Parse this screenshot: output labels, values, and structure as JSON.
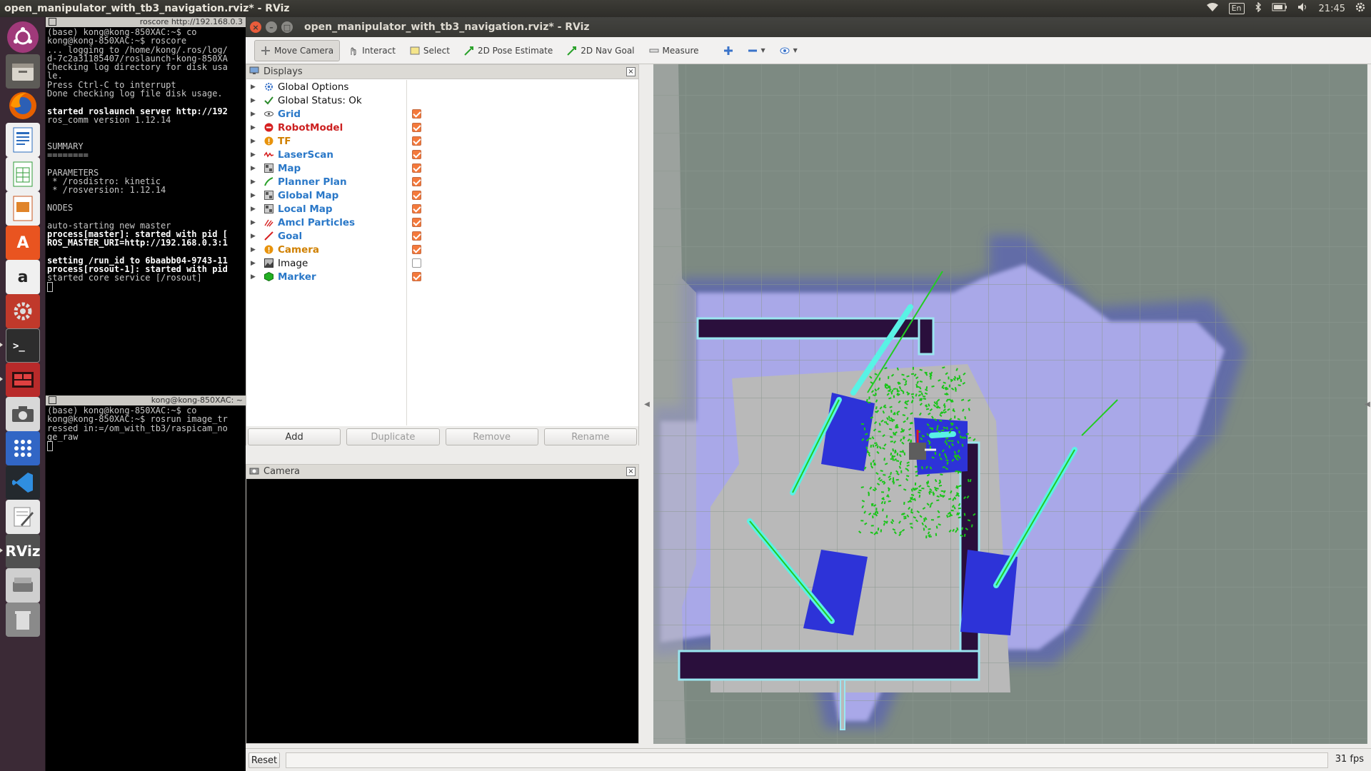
{
  "top_panel": {
    "title": "open_manipulator_with_tb3_navigation.rviz* - RViz",
    "keyboard": "En",
    "clock": "21:45"
  },
  "terminal1": {
    "title": "roscore http://192.168.0.3",
    "lines": [
      {
        "t": "(base) kong@kong-850XAC:~$ co",
        "b": false
      },
      {
        "t": "kong@kong-850XAC:~$ roscore",
        "b": false
      },
      {
        "t": "... logging to /home/kong/.ros/log/",
        "b": false
      },
      {
        "t": "d-7c2a31185407/roslaunch-kong-850XA",
        "b": false
      },
      {
        "t": "Checking log directory for disk usa",
        "b": false
      },
      {
        "t": "le.",
        "b": false
      },
      {
        "t": "Press Ctrl-C to interrupt",
        "b": false
      },
      {
        "t": "Done checking log file disk usage.",
        "b": false
      },
      {
        "t": "",
        "b": false
      },
      {
        "t": "started roslaunch server http://192",
        "b": true
      },
      {
        "t": "ros_comm version 1.12.14",
        "b": false
      },
      {
        "t": "",
        "b": false
      },
      {
        "t": "",
        "b": false
      },
      {
        "t": "SUMMARY",
        "b": false
      },
      {
        "t": "========",
        "b": false
      },
      {
        "t": "",
        "b": false
      },
      {
        "t": "PARAMETERS",
        "b": false
      },
      {
        "t": " * /rosdistro: kinetic",
        "b": false
      },
      {
        "t": " * /rosversion: 1.12.14",
        "b": false
      },
      {
        "t": "",
        "b": false
      },
      {
        "t": "NODES",
        "b": false
      },
      {
        "t": "",
        "b": false
      },
      {
        "t": "auto-starting new master",
        "b": false
      },
      {
        "t": "process[master]: started with pid [",
        "b": true
      },
      {
        "t": "ROS_MASTER_URI=http://192.168.0.3:1",
        "b": true
      },
      {
        "t": "",
        "b": false
      },
      {
        "t": "setting /run_id to 6baabb04-9743-11",
        "b": true
      },
      {
        "t": "process[rosout-1]: started with pid",
        "b": true
      },
      {
        "t": "started core service [/rosout]",
        "b": false
      }
    ]
  },
  "terminal2": {
    "title": "kong@kong-850XAC: ~",
    "lines": [
      {
        "t": "(base) kong@kong-850XAC:~$ co",
        "b": false
      },
      {
        "t": "kong@kong-850XAC:~$ rosrun image_tr",
        "b": false
      },
      {
        "t": "ressed in:=/om_with_tb3/raspicam_no",
        "b": false
      },
      {
        "t": "ge_raw",
        "b": false
      }
    ]
  },
  "window": {
    "title": "open_manipulator_with_tb3_navigation.rviz* - RViz"
  },
  "toolbar": {
    "tools": [
      {
        "label": "Move Camera",
        "icon": "move-camera-icon",
        "active": true
      },
      {
        "label": "Interact",
        "icon": "interact-icon",
        "active": false
      },
      {
        "label": "Select",
        "icon": "select-icon",
        "active": false
      },
      {
        "label": "2D Pose Estimate",
        "icon": "pose-estimate-icon",
        "active": false
      },
      {
        "label": "2D Nav Goal",
        "icon": "nav-goal-icon",
        "active": false
      },
      {
        "label": "Measure",
        "icon": "measure-icon",
        "active": false
      }
    ]
  },
  "displays": {
    "title": "Displays",
    "items": [
      {
        "label": "Global Options",
        "style": "plain",
        "icon": "gear-icon",
        "checked": null
      },
      {
        "label": "Global Status: Ok",
        "style": "plain",
        "icon": "check-icon",
        "checked": null
      },
      {
        "label": "Grid",
        "style": "blue",
        "icon": "grid-icon",
        "checked": true
      },
      {
        "label": "RobotModel",
        "style": "red",
        "icon": "error-icon",
        "checked": true
      },
      {
        "label": "TF",
        "style": "orange",
        "icon": "warning-icon",
        "checked": true
      },
      {
        "label": "LaserScan",
        "style": "blue",
        "icon": "laserscan-icon",
        "checked": true
      },
      {
        "label": "Map",
        "style": "blue",
        "icon": "map-icon",
        "checked": true
      },
      {
        "label": "Planner Plan",
        "style": "blue",
        "icon": "path-icon",
        "checked": true
      },
      {
        "label": "Global Map",
        "style": "blue",
        "icon": "map-icon",
        "checked": true
      },
      {
        "label": "Local Map",
        "style": "blue",
        "icon": "map-icon",
        "checked": true
      },
      {
        "label": "Amcl Particles",
        "style": "blue",
        "icon": "particles-icon",
        "checked": true
      },
      {
        "label": "Goal",
        "style": "blue",
        "icon": "goal-icon",
        "checked": true
      },
      {
        "label": "Camera",
        "style": "orange",
        "icon": "warning-icon",
        "checked": true
      },
      {
        "label": "Image",
        "style": "plain",
        "icon": "image-icon",
        "checked": false
      },
      {
        "label": "Marker",
        "style": "blue",
        "icon": "marker-icon",
        "checked": true
      }
    ],
    "buttons": {
      "add": "Add",
      "duplicate": "Duplicate",
      "remove": "Remove",
      "rename": "Rename"
    }
  },
  "camera_panel": {
    "title": "Camera"
  },
  "bottom": {
    "reset": "Reset",
    "fps": "31 fps"
  },
  "colors": {
    "accent_check": "#f4793b",
    "map_free": "#b9b9b9",
    "map_unknown": "#7d8a82",
    "costmap_inflation": "#a9a8e8",
    "wall": "#2a0f3c",
    "particles": "#19c419"
  }
}
